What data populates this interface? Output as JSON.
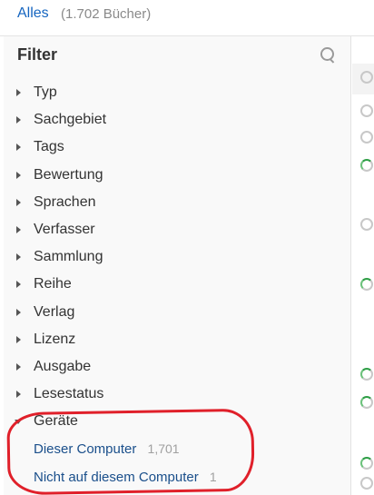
{
  "topbar": {
    "all_label": "Alles",
    "count_label": "(1.702 Bücher)"
  },
  "filter_panel": {
    "title": "Filter",
    "search_icon": "search-icon",
    "items": [
      {
        "label": "Typ",
        "expanded": false
      },
      {
        "label": "Sachgebiet",
        "expanded": false
      },
      {
        "label": "Tags",
        "expanded": false
      },
      {
        "label": "Bewertung",
        "expanded": false
      },
      {
        "label": "Sprachen",
        "expanded": false
      },
      {
        "label": "Verfasser",
        "expanded": false
      },
      {
        "label": "Sammlung",
        "expanded": false
      },
      {
        "label": "Reihe",
        "expanded": false
      },
      {
        "label": "Verlag",
        "expanded": false
      },
      {
        "label": "Lizenz",
        "expanded": false
      },
      {
        "label": "Ausgabe",
        "expanded": false
      },
      {
        "label": "Lesestatus",
        "expanded": false
      },
      {
        "label": "Geräte",
        "expanded": true
      }
    ],
    "device_options": [
      {
        "label": "Dieser Computer",
        "count": "1,701"
      },
      {
        "label": "Nicht auf diesem Computer",
        "count": "1"
      }
    ]
  },
  "colors": {
    "link": "#1565c0",
    "annotation": "#e0202a",
    "loader_green": "#2e9e46"
  }
}
